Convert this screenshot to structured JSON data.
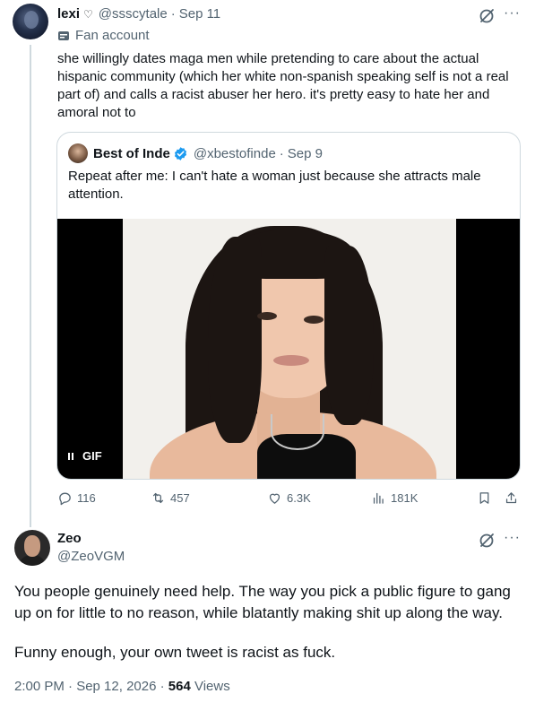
{
  "parent_tweet": {
    "name": "lexi",
    "handle": "@ssscytale",
    "date": "Sep 11",
    "label": "Fan account",
    "text": "she willingly dates maga men while pretending to care about the actual hispanic community (which her white non-spanish speaking self is not a real part of) and calls a racist abuser her hero. it's pretty easy to hate her and amoral not to",
    "quote": {
      "name": "Best of Inde",
      "handle": "@xbestofinde",
      "date": "Sep 9",
      "text": "Repeat after me: I can't hate a woman just because she attracts male attention.",
      "media_badge": "GIF"
    },
    "stats": {
      "replies": "116",
      "reposts": "457",
      "likes": "6.3K",
      "views": "181K"
    }
  },
  "reply_tweet": {
    "name": "Zeo",
    "handle": "@ZeoVGM",
    "paragraph_1": "You people genuinely need help. The way you pick a public figure to gang up on for little to no reason, while blatantly making shit up along the way.",
    "paragraph_2": "Funny enough, your own tweet is racist as fuck.",
    "timestamp": "2:00 PM · Sep 12, 2026",
    "views_count": "564",
    "views_label": "Views"
  },
  "colors": {
    "text": "#0f1419",
    "secondary": "#536471",
    "border": "#cfd9de",
    "verified": "#1d9bf0"
  }
}
